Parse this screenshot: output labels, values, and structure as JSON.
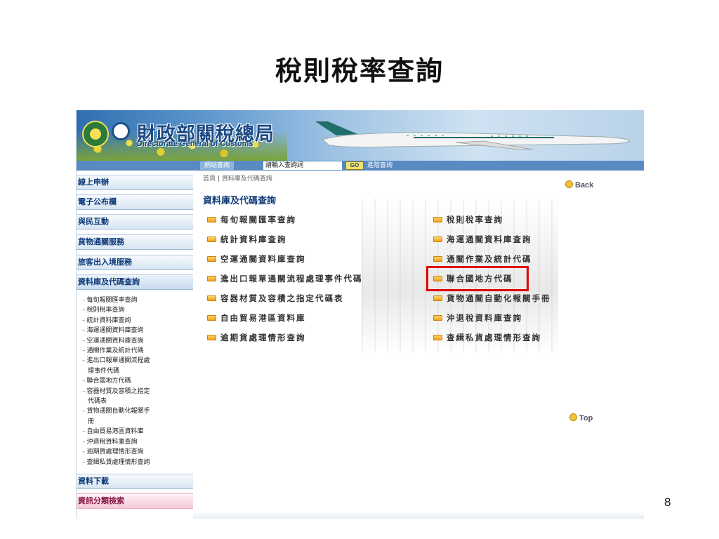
{
  "slide": {
    "title": "稅則稅率查詢",
    "page_number": "8"
  },
  "banner": {
    "logo_cn": "財政部關稅總局",
    "logo_en": "Directorate General of Customs"
  },
  "searchbar": {
    "tab_label": "網站查詢",
    "input_value": "請輸入查詢詞",
    "go_label": "GO",
    "advanced_label": "進階查詢"
  },
  "sidebar": {
    "items": [
      {
        "label": "線上申辦"
      },
      {
        "label": "電子公布欄"
      },
      {
        "label": "與民互動"
      },
      {
        "label": "貨物通關服務"
      },
      {
        "label": "旅客出入境服務"
      },
      {
        "label": "資料庫及代碼查詢"
      }
    ],
    "submenu": [
      {
        "label": "每旬報關匯率查詢",
        "cont": ""
      },
      {
        "label": "稅則稅率查詢",
        "cont": ""
      },
      {
        "label": "統計資料庫查詢",
        "cont": ""
      },
      {
        "label": "海運通關資料庫查詢",
        "cont": ""
      },
      {
        "label": "空運通關資料庫查詢",
        "cont": ""
      },
      {
        "label": "通關作業及統計代碼",
        "cont": ""
      },
      {
        "label": "進出口報單通關流程處",
        "cont": "理事件代碼"
      },
      {
        "label": "聯合國地方代碼",
        "cont": ""
      },
      {
        "label": "容器材質及容積之指定",
        "cont": "代碼表"
      },
      {
        "label": "貨物通關自動化報關手",
        "cont": "冊"
      },
      {
        "label": "自由貿易港區資料庫",
        "cont": ""
      },
      {
        "label": "沖退稅資料庫查詢",
        "cont": ""
      },
      {
        "label": "逾期貨處理情形查詢",
        "cont": ""
      },
      {
        "label": "查緝私貨處理情形查詢",
        "cont": ""
      }
    ],
    "bottom_items": [
      {
        "label": "資料下載"
      },
      {
        "label": "資訊分類檢索"
      }
    ]
  },
  "main": {
    "breadcrumb": "首頁 | 資料庫及代碼查詢",
    "back_label": "Back",
    "section_title": "資料庫及代碼查詢",
    "links_left": [
      "每旬報關匯率查詢",
      "統計資料庫查詢",
      "空運通關資料庫查詢",
      "進出口報單通關流程處理事件代碼",
      "容器材質及容積之指定代碼表",
      "自由貿易港區資料庫",
      "逾期貨處理情形查詢"
    ],
    "links_right": [
      "稅則稅率查詢",
      "海運通關資料庫查詢",
      "通關作業及統計代碼",
      "聯合國地方代碼",
      "貨物通關自動化報關手冊",
      "沖退稅資料庫查詢",
      "查緝私貨處理情形查詢"
    ],
    "top_label": "Top"
  },
  "colors": {
    "highlight": "#e00000",
    "nav_text": "#0e3a78",
    "link_icon": "#f0a21e"
  }
}
